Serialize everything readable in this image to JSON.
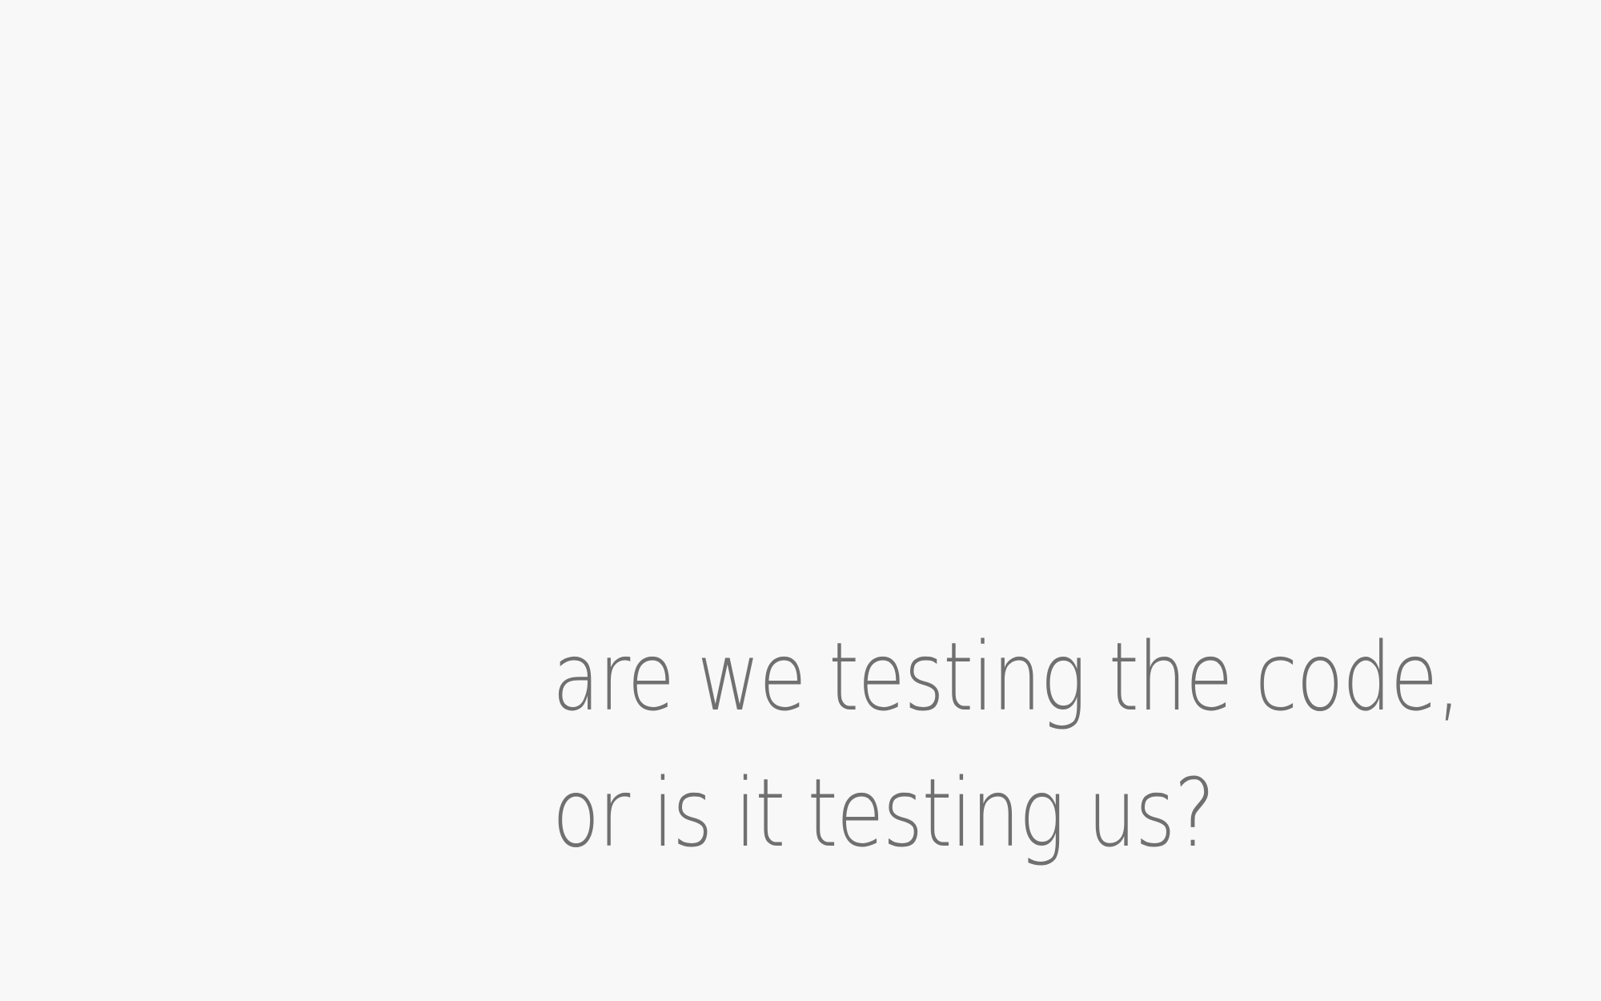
{
  "quote": {
    "line1": "are we testing the code,",
    "line2": "or is it testing us?"
  },
  "colors": {
    "background": "#f8f8f8",
    "text": "#707070"
  }
}
